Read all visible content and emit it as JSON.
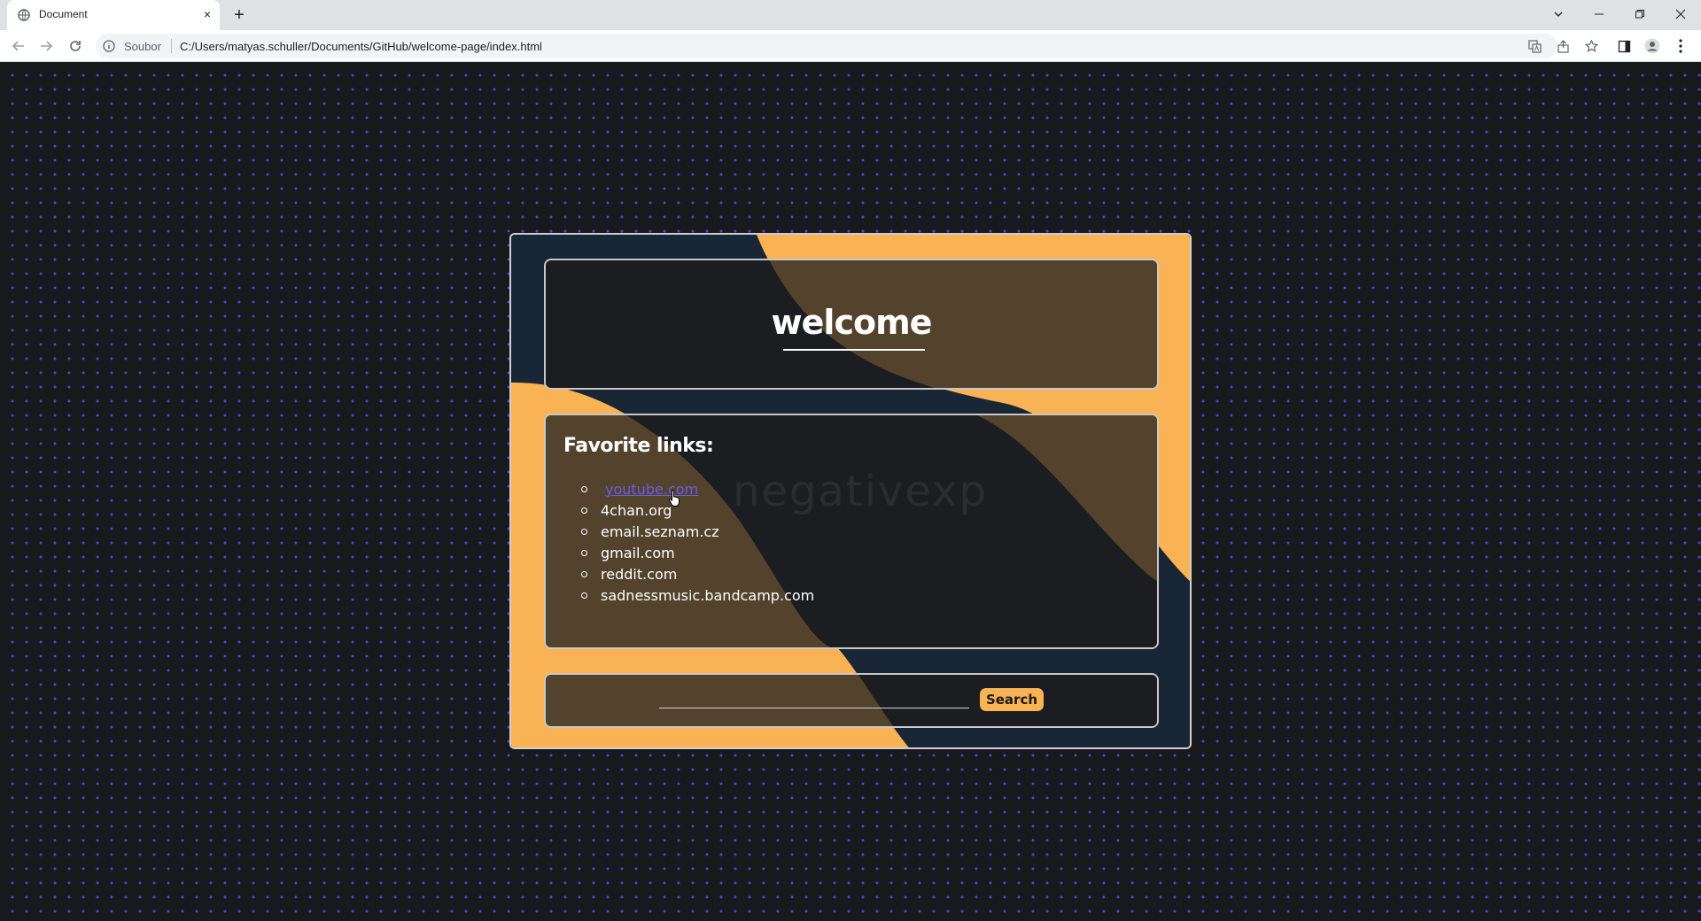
{
  "browser": {
    "tab_title": "Document",
    "new_tab_symbol": "+",
    "close_symbol": "×",
    "scheme_label": "Soubor",
    "url": "C:/Users/matyas.schuller/Documents/GitHub/welcome-page/index.html"
  },
  "page": {
    "title": "welcome",
    "links_heading": "Favorite links:",
    "links": [
      "youtube.com",
      "4chan.org",
      "email.seznam.cz",
      "gmail.com",
      "reddit.com",
      "sadnessmusic.bandcamp.com"
    ],
    "watermark": "negativexp",
    "search_button": "Search",
    "search_value": ""
  },
  "colors": {
    "page_background": "#18191c",
    "dot_pattern": "#5b3fd8",
    "card_navy": "#182636",
    "accent_orange": "#f9b354",
    "panel_dark": "#1c1d21",
    "panel_brown": "#54432c",
    "link_active": "#6c5ce7"
  }
}
